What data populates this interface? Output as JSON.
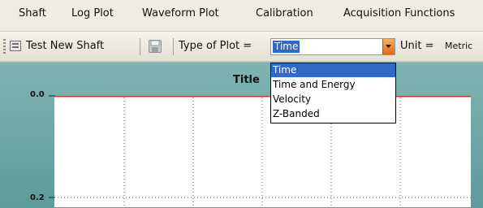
{
  "menu": {
    "items": [
      "Shaft",
      "Log Plot",
      "Waveform Plot",
      "Calibration",
      "Acquisition Functions"
    ]
  },
  "toolbar": {
    "test_new_shaft_label": "Test New Shaft",
    "type_of_plot_label": "Type of Plot =",
    "type_of_plot_value": "Time",
    "unit_label": "Unit =",
    "unit_value": "Metric"
  },
  "plot_dropdown": {
    "options": [
      "Time",
      "Time and Energy",
      "Velocity",
      "Z-Banded"
    ],
    "selected": "Time"
  },
  "plot": {
    "title": "Title",
    "y_ticks": [
      "0.0",
      "0.2"
    ],
    "accent_line_color": "#e03030"
  },
  "colors": {
    "selection": "#316ac5",
    "plot_background": "#6aa6a6",
    "combo_button": "#f08a30"
  }
}
